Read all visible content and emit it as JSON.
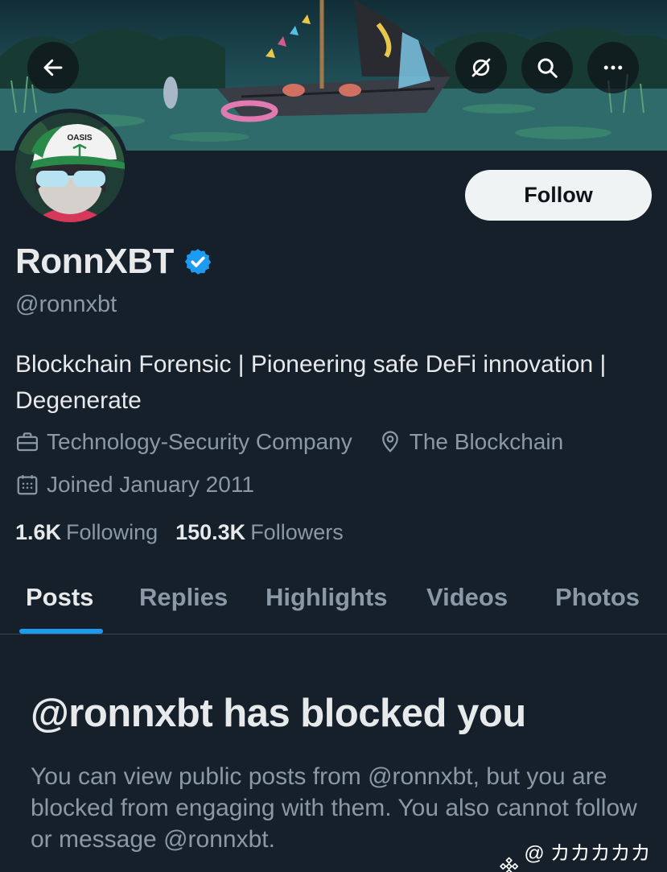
{
  "header": {
    "back_icon": "arrow-left-icon",
    "grok_icon": "grok-icon",
    "search_icon": "search-icon",
    "more_icon": "more-horizontal-icon"
  },
  "profile": {
    "display_name": "RonnXBT",
    "handle": "@ronnxbt",
    "avatar_cap_text": "OASIS",
    "bio": "Blockchain Forensic | Pioneering safe DeFi innovation | Degenerate",
    "category": "Technology-Security Company",
    "location": "The Blockchain",
    "joined": "Joined January 2011",
    "following_count": "1.6K",
    "following_label": "Following",
    "followers_count": "150.3K",
    "followers_label": "Followers",
    "follow_button": "Follow"
  },
  "tabs": [
    {
      "label": "Posts",
      "active": true
    },
    {
      "label": "Replies",
      "active": false
    },
    {
      "label": "Highlights",
      "active": false
    },
    {
      "label": "Videos",
      "active": false
    },
    {
      "label": "Photos",
      "active": false
    }
  ],
  "blocked": {
    "title": "@ronnxbt has blocked you",
    "message": "You can view public posts from @ronnxbt, but you are blocked from engaging with them. You also cannot follow or message @ronnxbt."
  },
  "watermark": {
    "text": "@ カカカカカカ"
  },
  "colors": {
    "background": "#15202b",
    "primary_text": "#e7e9ea",
    "secondary_text": "#8b98a5",
    "accent": "#1d9bf0",
    "verified": "#1d9bf0",
    "follow_button_bg": "#eff3f4"
  }
}
